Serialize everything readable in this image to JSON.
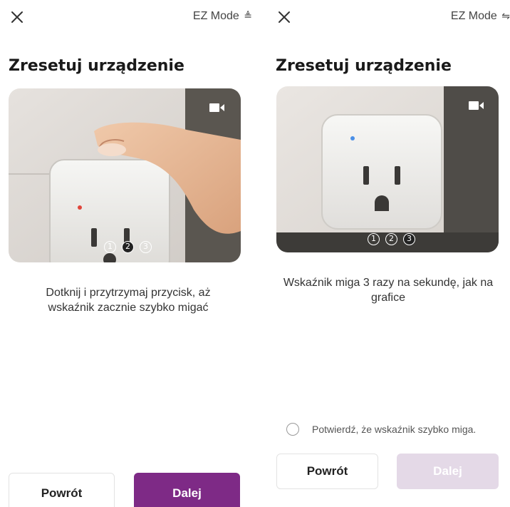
{
  "left": {
    "mode_label": "EZ Mode",
    "mode_icon": "≜",
    "title": "Zresetuj urządzenie",
    "steps": [
      "1",
      "2",
      "3"
    ],
    "active_step": 2,
    "caption_line1": "Dotknij i przytrzymaj przycisk, aż",
    "caption_line2": "wskaźnik zacznie szybko migać",
    "back_label": "Powrót",
    "next_label": "Dalej"
  },
  "right": {
    "mode_label": "EZ Mode",
    "mode_icon": "⇋",
    "title": "Zresetuj urządzenie",
    "steps": [
      "1",
      "2",
      "3"
    ],
    "active_step": 3,
    "caption_line1": "Wskaźnik miga 3 razy na sekundę, jak na",
    "caption_line2": "grafice",
    "confirm_label": "Potwierdź, że wskaźnik szybko miga.",
    "back_label": "Powrót",
    "next_label": "Dalej"
  },
  "colors": {
    "primary": "#7e2a86",
    "primary_disabled": "#e4d9e7",
    "indicator_red": "#e0453a",
    "indicator_blue": "#4a8fe7"
  },
  "icons": {
    "close": "close-icon",
    "video": "video-camera-icon",
    "mode": "ez-mode-icon"
  }
}
